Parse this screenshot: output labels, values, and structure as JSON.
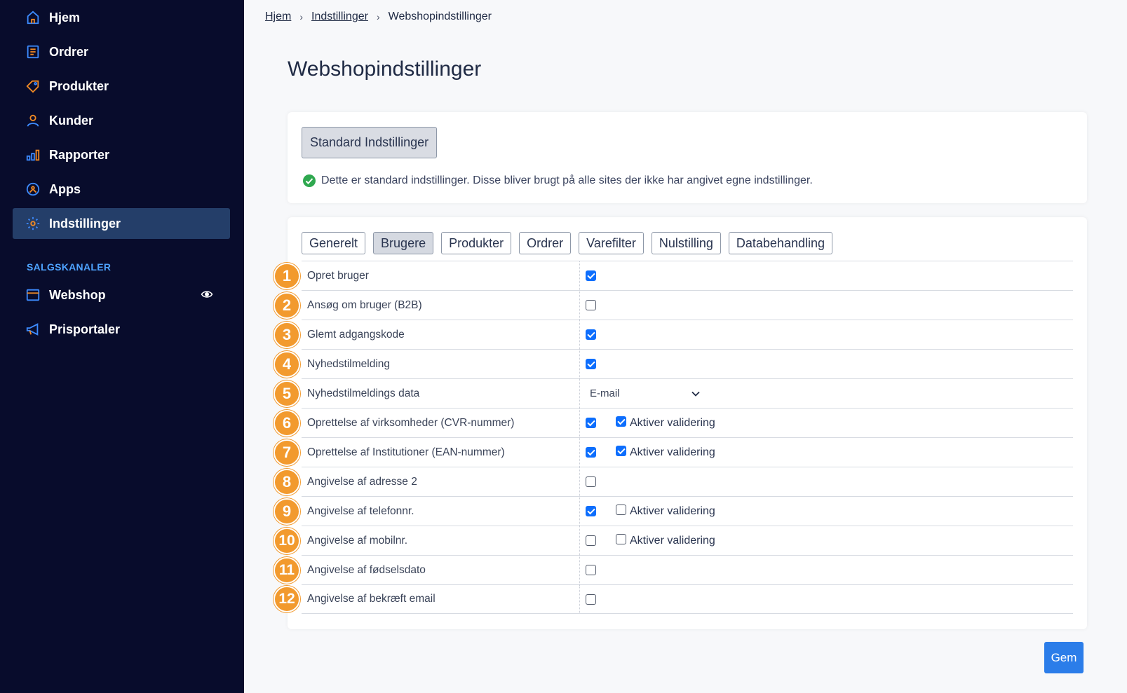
{
  "sidebar": {
    "items": [
      {
        "label": "Hjem",
        "icon": "home-icon"
      },
      {
        "label": "Ordrer",
        "icon": "orders-icon"
      },
      {
        "label": "Produkter",
        "icon": "tag-icon"
      },
      {
        "label": "Kunder",
        "icon": "user-icon"
      },
      {
        "label": "Rapporter",
        "icon": "bar-chart-icon"
      },
      {
        "label": "Apps",
        "icon": "apps-icon"
      },
      {
        "label": "Indstillinger",
        "icon": "gear-icon",
        "active": true
      }
    ],
    "section_label": "SALGSKANALER",
    "channels": [
      {
        "label": "Webshop",
        "icon": "store-icon"
      },
      {
        "label": "Prisportaler",
        "icon": "megaphone-icon"
      }
    ]
  },
  "breadcrumb": {
    "items": [
      "Hjem",
      "Indstillinger"
    ],
    "current": "Webshopindstillinger"
  },
  "page_title": "Webshopindstillinger",
  "standard": {
    "button_label": "Standard Indstillinger",
    "note": "Dette er standard indstillinger. Disse bliver brugt på alle sites der ikke har angivet egne indstillinger."
  },
  "tabs": [
    "Generelt",
    "Brugere",
    "Produkter",
    "Ordrer",
    "Varefilter",
    "Nulstilling",
    "Databehandling"
  ],
  "active_tab": "Brugere",
  "validation_label": "Aktiver validering",
  "rows": [
    {
      "num": "1",
      "label": "Opret bruger",
      "checked": true
    },
    {
      "num": "2",
      "label": "Ansøg om bruger (B2B)",
      "checked": false
    },
    {
      "num": "3",
      "label": "Glemt adgangskode",
      "checked": true
    },
    {
      "num": "4",
      "label": "Nyhedstilmelding",
      "checked": true
    },
    {
      "num": "5",
      "label": "Nyhedstilmeldings data",
      "select": "E-mail"
    },
    {
      "num": "6",
      "label": "Oprettelse af virksomheder (CVR-nummer)",
      "checked": true,
      "validation": true
    },
    {
      "num": "7",
      "label": "Oprettelse af Institutioner (EAN-nummer)",
      "checked": true,
      "validation": true
    },
    {
      "num": "8",
      "label": "Angivelse af adresse 2",
      "checked": false
    },
    {
      "num": "9",
      "label": "Angivelse af telefonnr.",
      "checked": true,
      "validation": false
    },
    {
      "num": "10",
      "label": "Angivelse af mobilnr.",
      "checked": false,
      "validation": false
    },
    {
      "num": "11",
      "label": "Angivelse af fødselsdato",
      "checked": false
    },
    {
      "num": "12",
      "label": "Angivelse af bekræft email",
      "checked": false
    }
  ],
  "save_label": "Gem",
  "colors": {
    "sidebar_bg": "#080c2c",
    "active_nav": "#243e69",
    "accent": "#2b7de9",
    "badge": "#f29a2e",
    "icon_orange": "#f28a24",
    "icon_blue": "#3d8bff"
  }
}
